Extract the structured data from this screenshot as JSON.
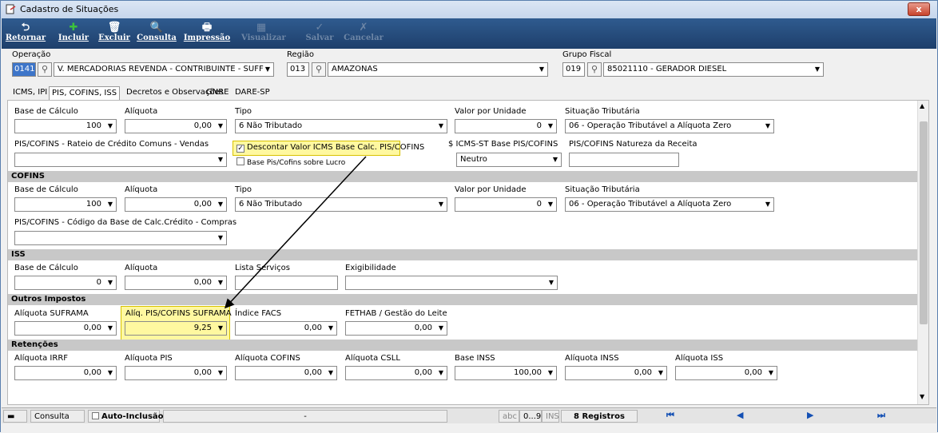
{
  "window": {
    "title": "Cadastro de Situações",
    "close_label": "x"
  },
  "toolbar": [
    {
      "label": "Retornar",
      "icon": "⮌",
      "enabled": true
    },
    {
      "label": "Incluir",
      "icon": "✚",
      "enabled": true
    },
    {
      "label": "Excluir",
      "icon": "🗑",
      "enabled": true
    },
    {
      "label": "Consulta",
      "icon": "🔍",
      "enabled": true
    },
    {
      "label": "Impressão",
      "icon": "🖶",
      "enabled": true
    },
    {
      "label": "Visualizar",
      "icon": "▦",
      "enabled": false
    },
    {
      "label": "Salvar",
      "icon": "✓",
      "enabled": false
    },
    {
      "label": "Cancelar",
      "icon": "✗",
      "enabled": false
    }
  ],
  "header": {
    "operacao_label": "Operação",
    "operacao_code": "0141",
    "operacao_value": "V. MERCADORIAS REVENDA - CONTRIBUINTE - SUFF",
    "regiao_label": "Região",
    "regiao_code": "013",
    "regiao_value": "AMAZONAS",
    "grupo_label": "Grupo Fiscal",
    "grupo_code": "019",
    "grupo_value": "85021110 - GERADOR DIESEL"
  },
  "tabs": [
    "ICMS, IPI",
    "PIS, COFINS, ISS",
    "Decretos e Observações",
    "GNRE",
    "DARE-SP"
  ],
  "pis": {
    "base_label": "Base de Cálculo",
    "base_value": "100",
    "aliq_label": "Alíquota",
    "aliq_value": "0,00",
    "tipo_label": "Tipo",
    "tipo_value": "6 Não Tributado",
    "vpu_label": "Valor por Unidade",
    "vpu_value": "0",
    "sit_label": "Situação Tributária",
    "sit_value": "06 - Operação Tributável a Alíquota Zero",
    "rateio_label": "PIS/COFINS - Rateio de Crédito Comuns - Vendas",
    "desc_label": "Descontar Valor ICMS Base Calc. PIS/COFINS",
    "lucro_label": "Base Pis/Cofins sobre Lucro",
    "st_label": "$ ICMS-ST Base PIS/COFINS",
    "st_value": "Neutro",
    "nat_label": "PIS/COFINS Natureza da Receita"
  },
  "cofins": {
    "title": "COFINS",
    "base_label": "Base de Cálculo",
    "base_value": "100",
    "aliq_label": "Alíquota",
    "aliq_value": "0,00",
    "tipo_label": "Tipo",
    "tipo_value": "6 Não Tributado",
    "vpu_label": "Valor por Unidade",
    "vpu_value": "0",
    "sit_label": "Situação Tributária",
    "sit_value": "06 - Operação Tributável a Alíquota Zero",
    "cod_label": "PIS/COFINS - Código da Base de Calc.Crédito - Compras"
  },
  "iss": {
    "title": "ISS",
    "base_label": "Base de Cálculo",
    "base_value": "0",
    "aliq_label": "Alíquota",
    "aliq_value": "0,00",
    "lista_label": "Lista Serviços",
    "exig_label": "Exigibilidade"
  },
  "outros": {
    "title": "Outros Impostos",
    "suf_label": "Alíquota SUFRAMA",
    "suf_value": "0,00",
    "pis_suf_label": "Alíq. PIS/COFINS SUFRAMA",
    "pis_suf_value": "9,25",
    "facs_label": "Índice FACS",
    "facs_value": "0,00",
    "fethab_label": "FETHAB / Gestão do Leite",
    "fethab_value": "0,00"
  },
  "ret": {
    "title": "Retenções",
    "fields": [
      {
        "label": "Alíquota IRRF",
        "value": "0,00"
      },
      {
        "label": "Alíquota PIS",
        "value": "0,00"
      },
      {
        "label": "Alíquota COFINS",
        "value": "0,00"
      },
      {
        "label": "Alíquota CSLL",
        "value": "0,00"
      },
      {
        "label": "Base INSS",
        "value": "100,00"
      },
      {
        "label": "Alíquota INSS",
        "value": "0,00"
      },
      {
        "label": "Alíquota ISS",
        "value": "0,00"
      }
    ]
  },
  "status": {
    "mode": "Consulta",
    "auto_label": "Auto-Inclusão",
    "dash": "-",
    "abc": "abc",
    "num": "0...9",
    "ins": "INS",
    "records": "8 Registros"
  },
  "colors": {
    "toolbar": "#1e3f6b",
    "section": "#c8c8c8",
    "highlight": "#fff8a0",
    "arrow": "#000000"
  }
}
